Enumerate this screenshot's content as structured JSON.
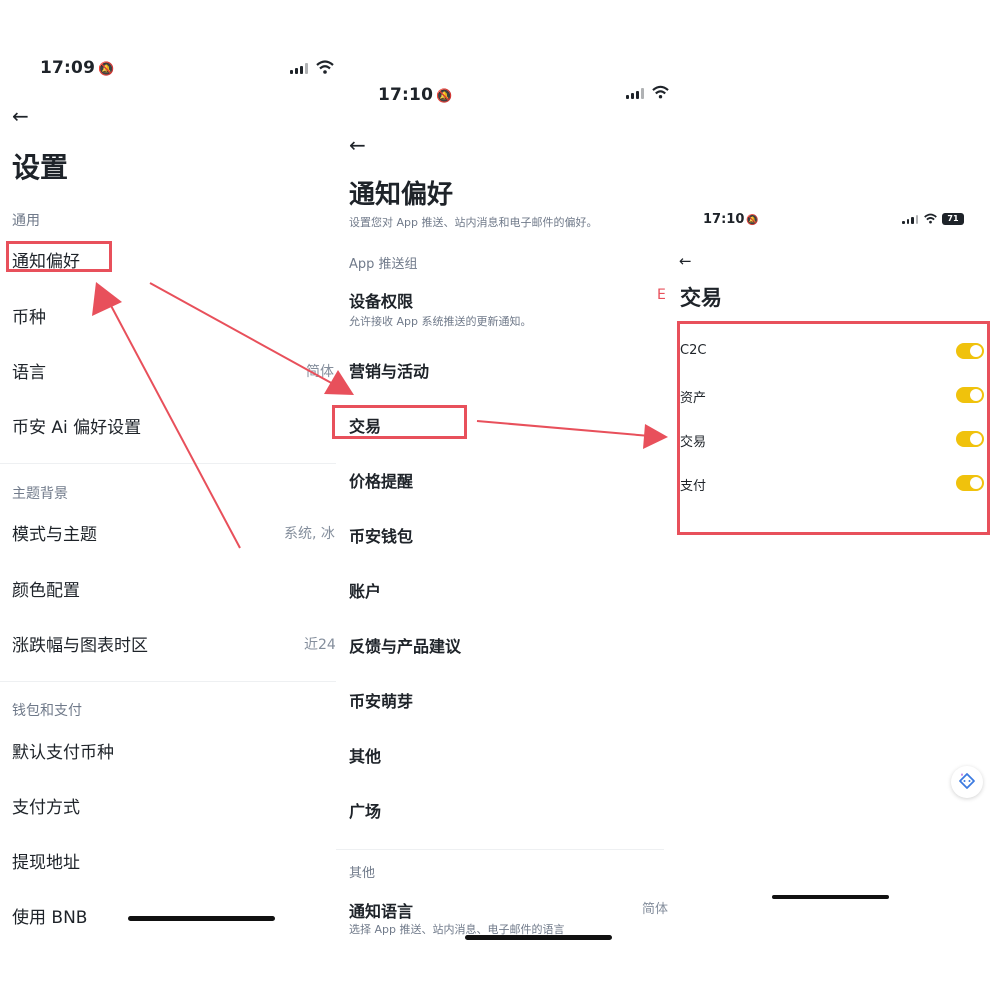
{
  "screen1": {
    "status": {
      "time": "17:09"
    },
    "title": "设置",
    "sections": {
      "general": "通用",
      "theme": "主题背景",
      "wallet": "钱包和支付"
    },
    "items": {
      "notify": "通知偏好",
      "currency": "币种",
      "language": "语言",
      "language_value": "简体",
      "ai": "币安 Ai 偏好设置",
      "mode": "模式与主题",
      "mode_value": "系统, 冰",
      "color": "颜色配置",
      "change": "涨跌幅与图表时区",
      "change_value": "近24",
      "default_pay": "默认支付币种",
      "pay_method": "支付方式",
      "withdraw": "提现地址",
      "bnb": "使用 BNB"
    }
  },
  "screen2": {
    "status": {
      "time": "17:10"
    },
    "title": "通知偏好",
    "subtitle": "设置您对 App 推送、站内消息和电子邮件的偏好。",
    "section_push": "App 推送组",
    "device": "设备权限",
    "device_desc": "允许接收 App 系统推送的更新通知。",
    "device_value": "E",
    "items": [
      "营销与活动",
      "交易",
      "价格提醒",
      "币安钱包",
      "账户",
      "反馈与产品建议",
      "币安萌芽",
      "其他",
      "广场"
    ],
    "section_other": "其他",
    "notify_lang": "通知语言",
    "notify_lang_desc": "选择 App 推送、站内消息、电子邮件的语言",
    "notify_lang_value": "简体"
  },
  "screen3": {
    "status": {
      "time": "17:10",
      "battery": "71"
    },
    "title": "交易",
    "toggles": [
      {
        "label": "C2C",
        "on": true
      },
      {
        "label": "资产",
        "on": true
      },
      {
        "label": "交易",
        "on": true
      },
      {
        "label": "支付",
        "on": true
      }
    ]
  },
  "colors": {
    "highlight": "#e8505b",
    "toggle_on": "#f0c20c"
  },
  "icons": [
    "back-arrow-icon",
    "bell-mute-icon",
    "signal-icon",
    "wifi-icon",
    "battery-icon",
    "ai-assistant-icon"
  ]
}
